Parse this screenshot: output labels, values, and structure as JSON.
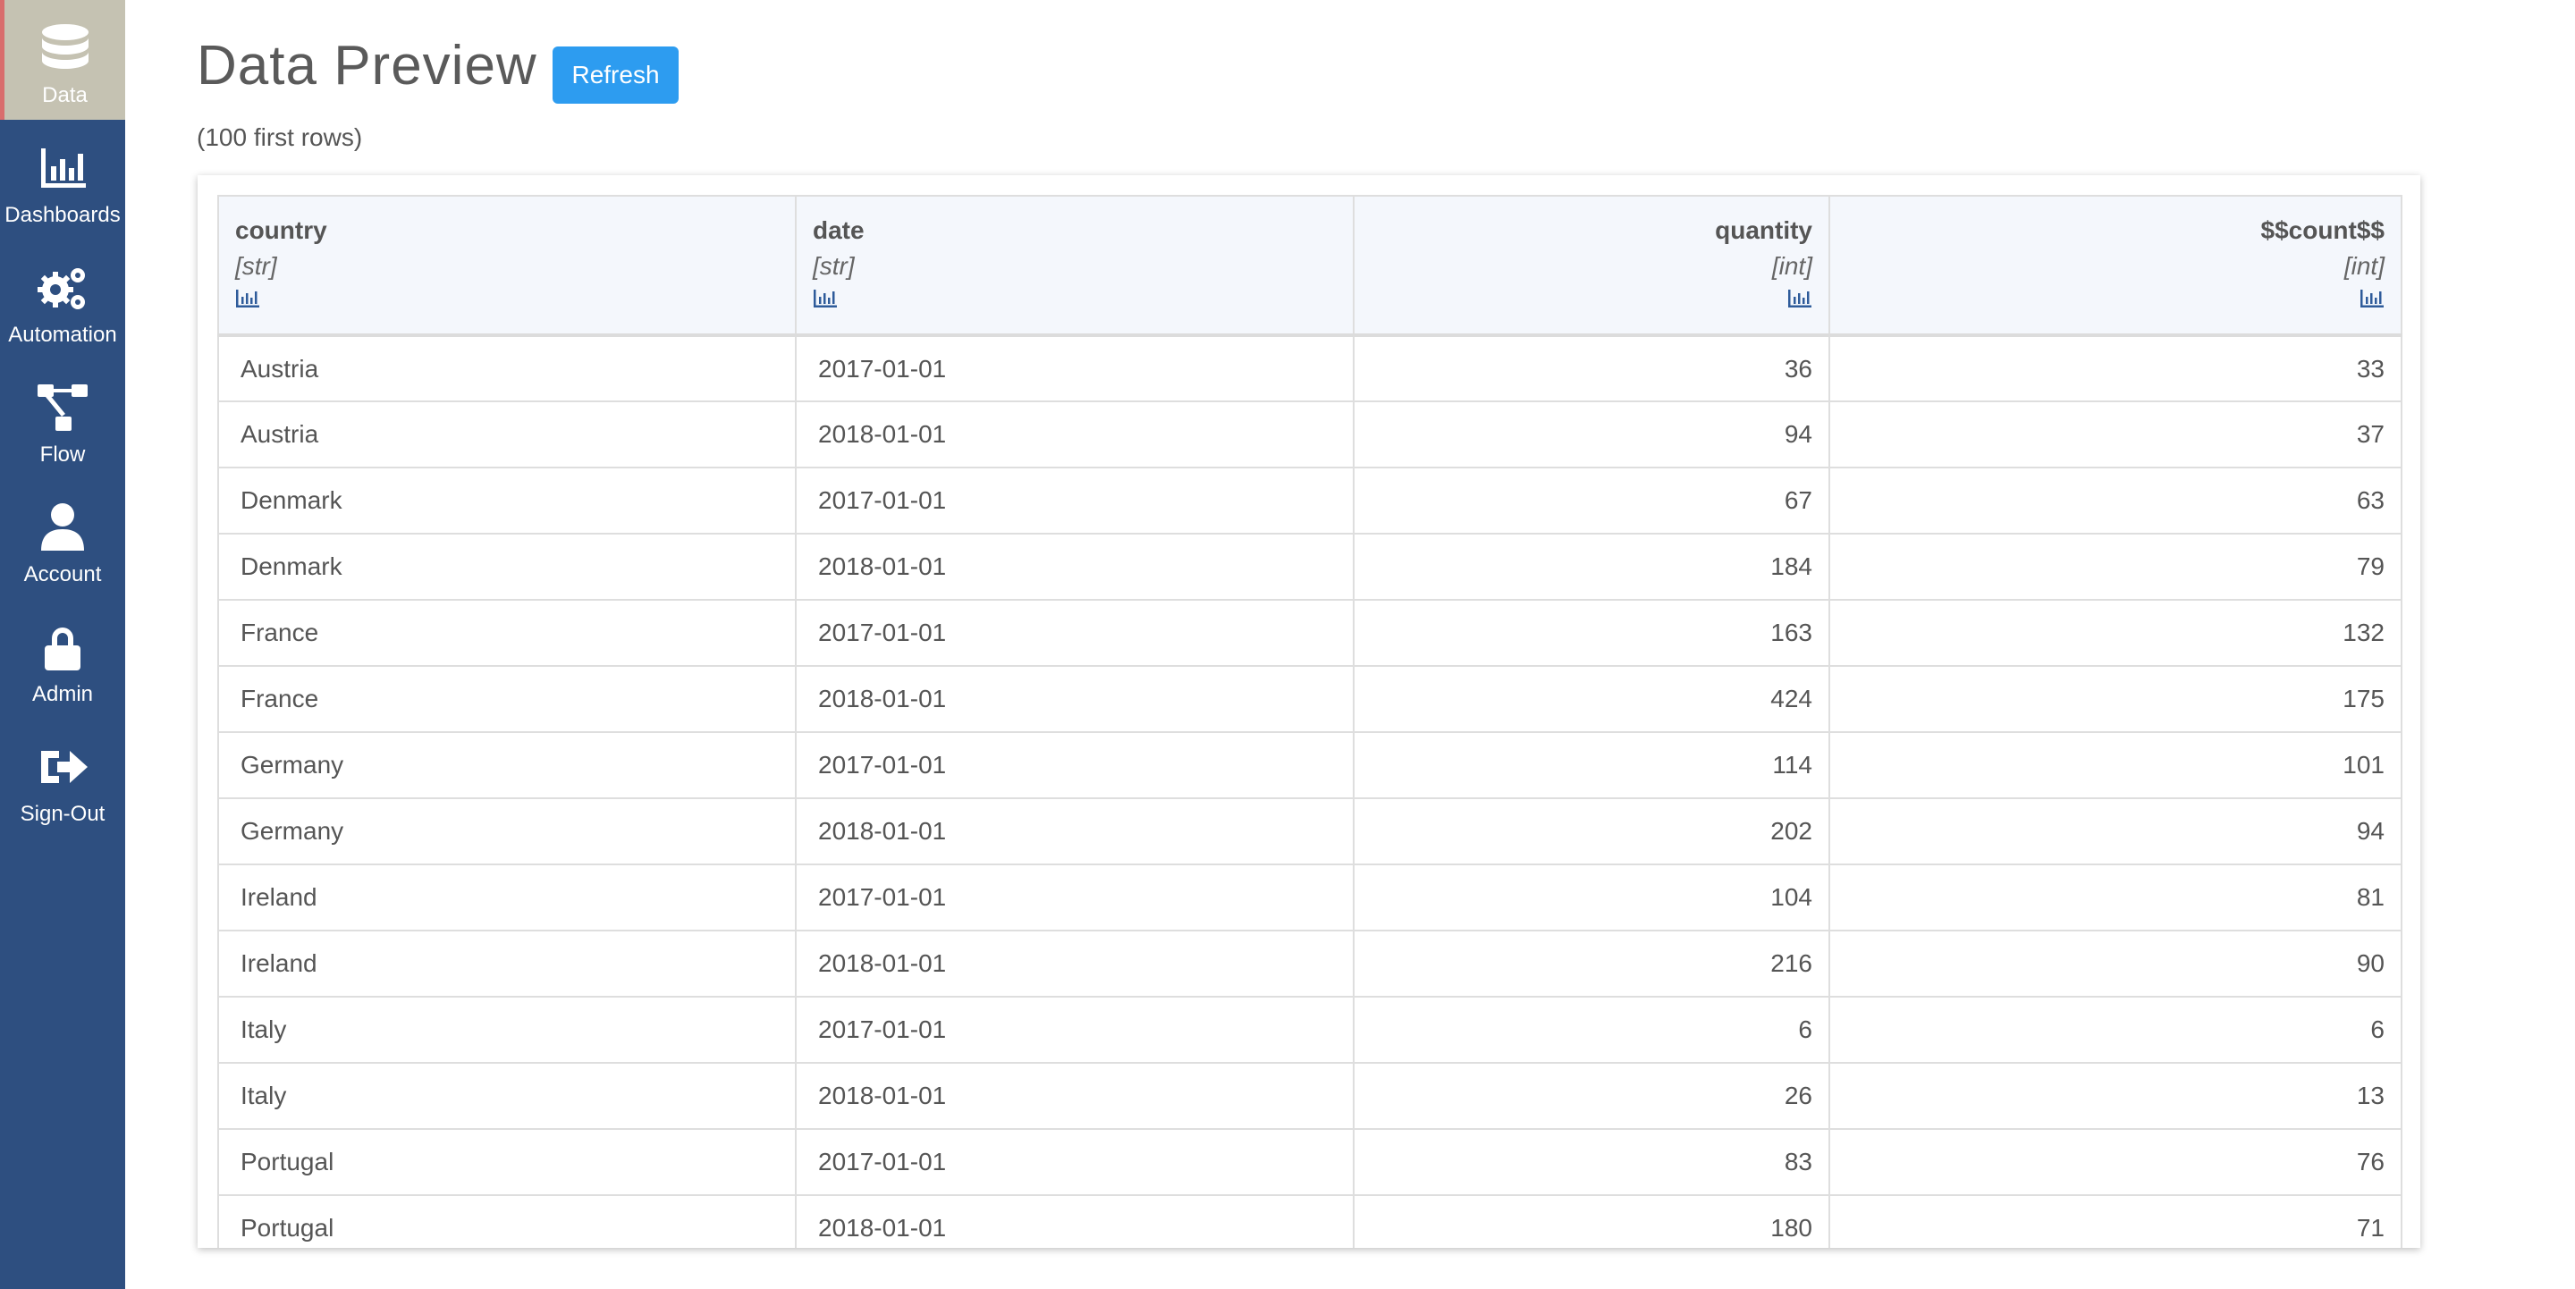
{
  "sidebar": {
    "items": [
      {
        "label": "Data",
        "icon": "database-icon",
        "active": true
      },
      {
        "label": "Dashboards",
        "icon": "bar-chart-icon"
      },
      {
        "label": "Automation",
        "icon": "gears-icon"
      },
      {
        "label": "Flow",
        "icon": "flow-icon"
      },
      {
        "label": "Account",
        "icon": "user-icon"
      },
      {
        "label": "Admin",
        "icon": "lock-icon"
      },
      {
        "label": "Sign-Out",
        "icon": "sign-out-icon"
      }
    ]
  },
  "header": {
    "title": "Data Preview",
    "refresh_label": "Refresh",
    "subtitle": "(100 first rows)"
  },
  "colors": {
    "sidebar": "#2e4f80",
    "active_item": "#c5c2b2",
    "active_marker": "#d96d6d",
    "button": "#2d9cf0",
    "header_row": "#f4f7fc"
  },
  "table": {
    "columns": [
      {
        "name": "country",
        "type": "[str]",
        "icon": "bar-chart-icon"
      },
      {
        "name": "date",
        "type": "[str]",
        "icon": "bar-chart-icon"
      },
      {
        "name": "quantity",
        "type": "[int]",
        "icon": "bar-chart-icon"
      },
      {
        "name": "$$count$$",
        "type": "[int]",
        "icon": "bar-chart-icon"
      }
    ],
    "rows": [
      [
        "Austria",
        "2017-01-01",
        "36",
        "33"
      ],
      [
        "Austria",
        "2018-01-01",
        "94",
        "37"
      ],
      [
        "Denmark",
        "2017-01-01",
        "67",
        "63"
      ],
      [
        "Denmark",
        "2018-01-01",
        "184",
        "79"
      ],
      [
        "France",
        "2017-01-01",
        "163",
        "132"
      ],
      [
        "France",
        "2018-01-01",
        "424",
        "175"
      ],
      [
        "Germany",
        "2017-01-01",
        "114",
        "101"
      ],
      [
        "Germany",
        "2018-01-01",
        "202",
        "94"
      ],
      [
        "Ireland",
        "2017-01-01",
        "104",
        "81"
      ],
      [
        "Ireland",
        "2018-01-01",
        "216",
        "90"
      ],
      [
        "Italy",
        "2017-01-01",
        "6",
        "6"
      ],
      [
        "Italy",
        "2018-01-01",
        "26",
        "13"
      ],
      [
        "Portugal",
        "2017-01-01",
        "83",
        "76"
      ],
      [
        "Portugal",
        "2018-01-01",
        "180",
        "71"
      ]
    ]
  }
}
